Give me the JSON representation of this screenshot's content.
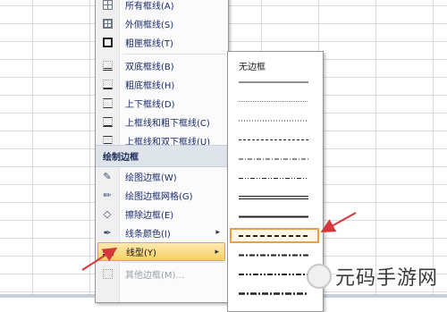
{
  "menu": {
    "items": [
      {
        "label": "所有框线(A)",
        "icon": "all-borders-icon"
      },
      {
        "label": "外侧框线(S)",
        "icon": "outside-borders-icon"
      },
      {
        "label": "粗匣框线(T)",
        "icon": "thick-box-border-icon"
      },
      {
        "label": "双底框线(B)",
        "icon": "bottom-double-border-icon"
      },
      {
        "label": "粗底框线(H)",
        "icon": "thick-bottom-border-icon"
      },
      {
        "label": "上下框线(D)",
        "icon": "top-bottom-border-icon"
      },
      {
        "label": "上框线和粗下框线(C)",
        "icon": "top-thick-bottom-border-icon"
      },
      {
        "label": "上框线和双下框线(U)",
        "icon": "top-double-bottom-border-icon"
      }
    ],
    "section_title": "绘制边框",
    "draw_items": [
      {
        "label": "绘图边框(W)",
        "icon": "draw-border-icon"
      },
      {
        "label": "绘图边框网格(G)",
        "icon": "draw-border-grid-icon"
      },
      {
        "label": "擦除边框(E)",
        "icon": "eraser-icon"
      },
      {
        "label": "线条颜色(I)",
        "icon": "line-color-icon"
      },
      {
        "label": "线型(Y)",
        "icon": "line-style-icon"
      },
      {
        "label": "其他边框(M)...",
        "icon": "more-borders-icon"
      }
    ],
    "submenu_arrow": "▸"
  },
  "submenu": {
    "none_label": "无边框",
    "styles": [
      "thin",
      "hair",
      "dotted",
      "dashed-fine",
      "dash-dot",
      "dash-dot-dot",
      "double",
      "medium",
      "medium-dashed",
      "medium-dash-dot",
      "medium-dash-dot-dot",
      "slanted-dash-dot"
    ],
    "selected_index": 8
  },
  "watermark": {
    "text": "元码手游网"
  },
  "colors": {
    "highlight": "#f9cf63",
    "arrow": "#d7373a",
    "selection_border": "#e8a13c"
  }
}
